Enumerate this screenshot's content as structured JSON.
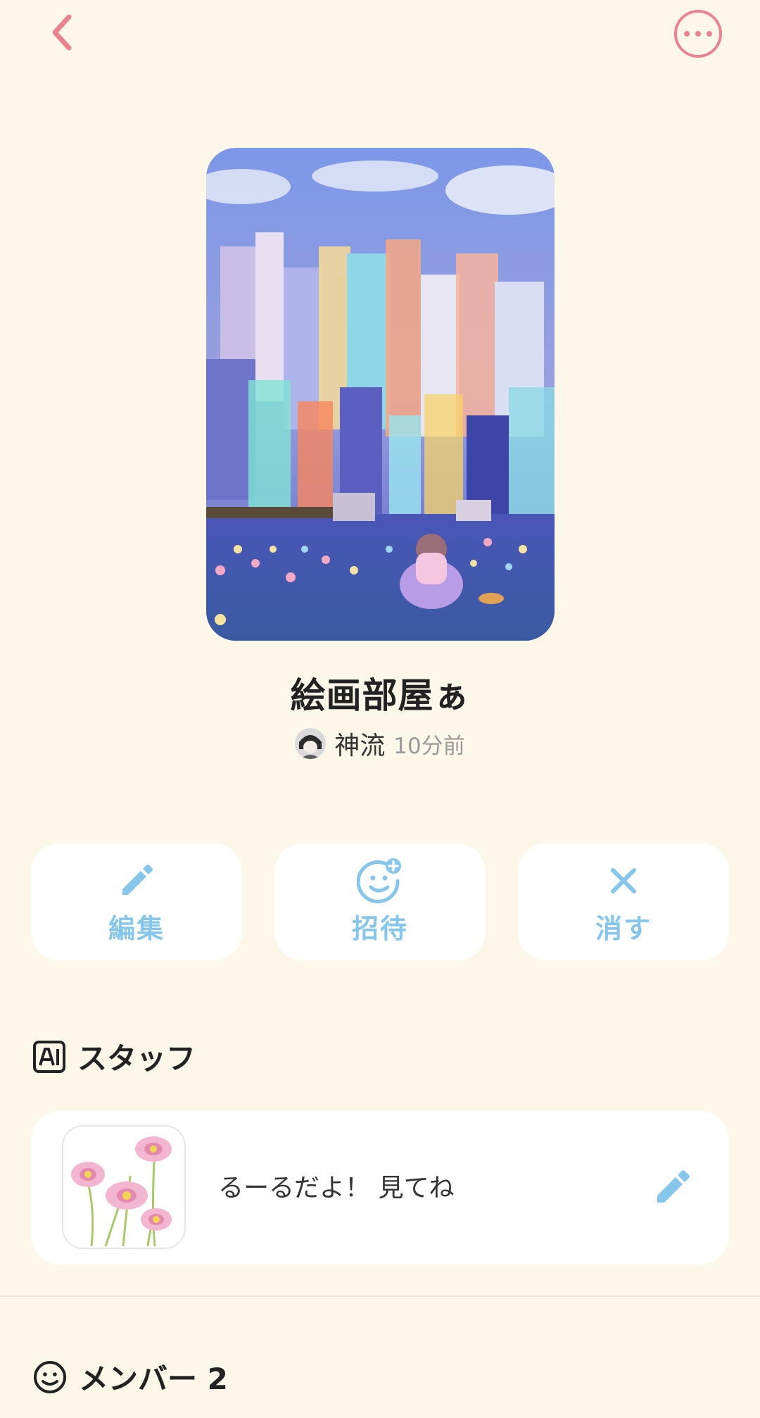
{
  "header": {
    "back_icon": "chevron-left-icon",
    "more_icon": "more-horizontal-icon",
    "accent": "#e9848f"
  },
  "room": {
    "title": "絵画部屋ぁ",
    "owner_name": "神流",
    "updated": "10分前"
  },
  "actions": [
    {
      "label": "編集",
      "icon": "pencil-icon"
    },
    {
      "label": "招待",
      "icon": "invite-smiley-icon"
    },
    {
      "label": "消す",
      "icon": "close-icon"
    }
  ],
  "action_color": "#86c6ea",
  "staff": {
    "section_title": "スタッフ",
    "section_icon": "ai-icon",
    "card_text": "るーるだよ！ 見てね",
    "edit_icon": "pencil-icon"
  },
  "members": {
    "section_title": "メンバー 2",
    "section_icon": "smiley-icon"
  },
  "background": "#fdf7ea"
}
